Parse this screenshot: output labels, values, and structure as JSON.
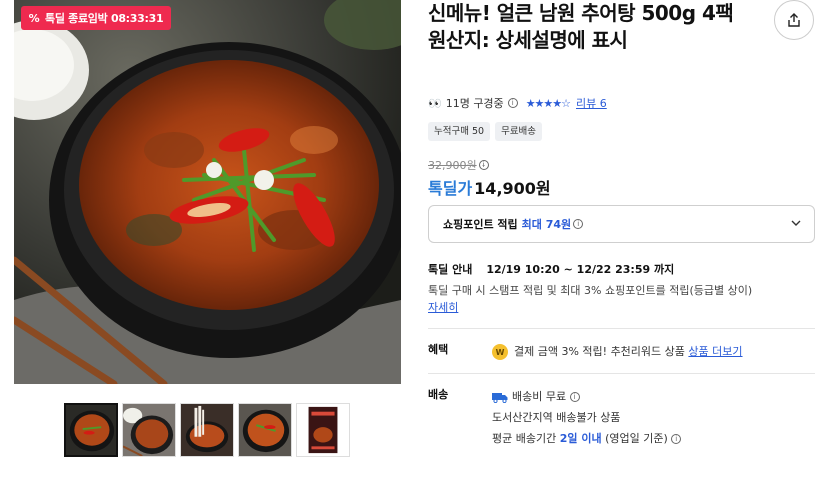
{
  "deal_badge": {
    "icon": "percent-icon",
    "label": "톡딜 종료임박 08:33:31"
  },
  "product": {
    "title": "신메뉴! 얼큰 남원 추어탕 500g 4팩",
    "origin": "원산지: 상세설명에 표시",
    "viewers": "11명 구경중",
    "rating_stars": "★★★★☆",
    "review_label": "리뷰 6",
    "chips": [
      "누적구매 50",
      "무료배송"
    ],
    "original_price": "32,900원",
    "price_label": "톡딜가",
    "price": "14,900원"
  },
  "points": {
    "label": "쇼핑포인트 적립",
    "max": "최대 74원"
  },
  "deal_info": {
    "label": "톡딜 안내",
    "period": "12/19 10:20 ~ 12/22 23:59 까지",
    "desc": "톡딜 구매 시 스탬프 적립 및 최대 3% 쇼핑포인트를 적립(등급별 상이)",
    "more": "자세히"
  },
  "benefit": {
    "label": "혜택",
    "text": "결제 금액 3% 적립! 추천리워드 상품",
    "link": "상품 더보기"
  },
  "shipping": {
    "label": "배송",
    "fee": "배송비 무료",
    "restriction": "도서산간지역 배송불가 상품",
    "avg_prefix": "평균 배송기간",
    "avg_days": "2일 이내",
    "avg_suffix": "(영업일 기준)"
  },
  "colors": {
    "accent": "#2a5bd7",
    "badge": "#ef2a4f",
    "price_label": "#2a7bd7"
  }
}
